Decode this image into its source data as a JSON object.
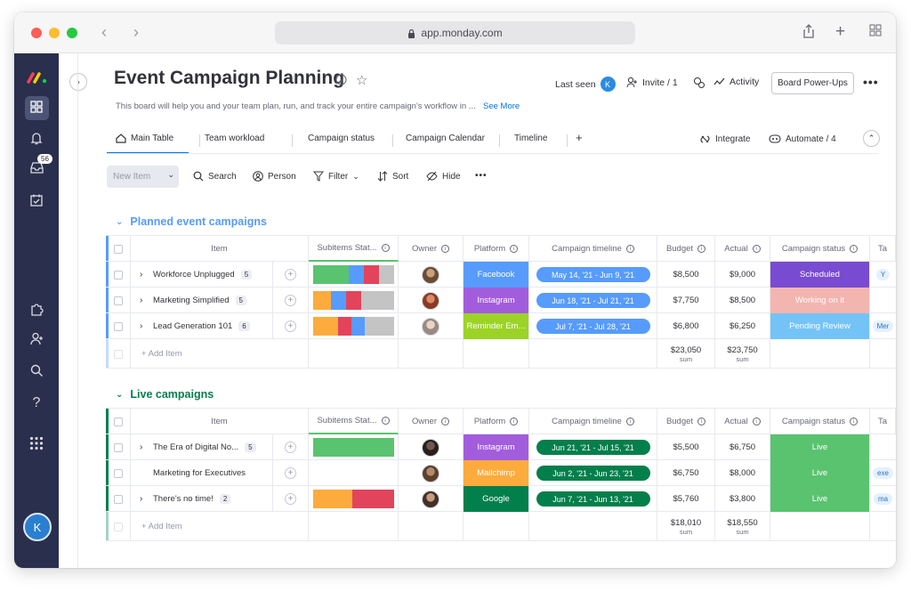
{
  "browser": {
    "url": "app.monday.com"
  },
  "colors": {
    "accent": "#0073ea",
    "group1": "#579bfc",
    "group2": "#037f4c",
    "facebook": "#579bfc",
    "instagram": "#a25ddc",
    "reminder": "#9cd326",
    "mailchimp": "#fdab3d",
    "google": "#037f4c",
    "timeline_blue": "#579bfc",
    "timeline_green": "#037f4c",
    "scheduled": "#784bd1",
    "working": "#f3b5b0",
    "pending": "#74c3f7",
    "live": "#5ac36f"
  },
  "rail": {
    "badge": "56",
    "avatar": "K",
    "icons": [
      "monday-logo-icon",
      "grid-icon",
      "bell-icon",
      "inbox-icon",
      "calendar-check-icon",
      "puzzle-icon",
      "add-user-icon",
      "search-icon",
      "help-icon",
      "apps-icon"
    ]
  },
  "header": {
    "title": "Event Campaign Planning",
    "last_seen": "Last seen",
    "last_seen_avatar": "K",
    "invite": "Invite / 1",
    "activity": "Activity",
    "powerups": "Board Power-Ups",
    "description": "This board will help you and your team plan, run, and track your entire campaign's workflow in ...",
    "see_more": "See More"
  },
  "tabs": [
    "Main Table",
    "Team workload",
    "Campaign status",
    "Campaign Calendar",
    "Timeline"
  ],
  "tabs_add": "+",
  "integrate": "Integrate",
  "automate": "Automate / 4",
  "toolbar": {
    "new_item": "New Item",
    "search": "Search",
    "person": "Person",
    "filter": "Filter",
    "sort": "Sort",
    "hide": "Hide"
  },
  "columns": {
    "item": "Item",
    "subitems": "Subitems Stat...",
    "owner": "Owner",
    "platform": "Platform",
    "timeline": "Campaign timeline",
    "budget": "Budget",
    "actual": "Actual",
    "status": "Campaign status",
    "tags": "Ta"
  },
  "groups": [
    {
      "title": "Planned event campaigns",
      "rows": [
        {
          "name": "Workforce Unplugged",
          "count": "5",
          "platform": "Facebook",
          "timeline": "May 14, '21 - Jun 9, '21",
          "budget": "$8,500",
          "actual": "$9,000",
          "status": "Scheduled",
          "tag": "Y"
        },
        {
          "name": "Marketing Simplified",
          "count": "5",
          "platform": "Instagram",
          "timeline": "Jun 18, '21 - Jul 21, '21",
          "budget": "$7,750",
          "actual": "$8,500",
          "status": "Working on it",
          "tag": ""
        },
        {
          "name": "Lead Generation 101",
          "count": "6",
          "platform": "Reminder Em...",
          "timeline": "Jul 7, '21 - Jul 28, '21",
          "budget": "$6,800",
          "actual": "$6,250",
          "status": "Pending Review",
          "tag": "Mer"
        }
      ],
      "add_item": "+ Add Item",
      "budget_sum": "$23,050",
      "actual_sum": "$23,750",
      "sum_label": "sum"
    },
    {
      "title": "Live campaigns",
      "rows": [
        {
          "name": "The Era of Digital No...",
          "count": "5",
          "platform": "Instagram",
          "timeline": "Jun 21, '21 - Jul 15, '21",
          "budget": "$5,500",
          "actual": "$6,750",
          "status": "Live",
          "tag": ""
        },
        {
          "name": "Marketing for Executives",
          "count": "",
          "platform": "Mailchimp",
          "timeline": "Jun 2, '21 - Jun 23, '21",
          "budget": "$6,750",
          "actual": "$8,000",
          "status": "Live",
          "tag": "exe"
        },
        {
          "name": "There's no time!",
          "count": "2",
          "platform": "Google",
          "timeline": "Jun 7, '21 - Jun 13, '21",
          "budget": "$5,760",
          "actual": "$3,800",
          "status": "Live",
          "tag": "ma"
        }
      ],
      "add_item": "+ Add Item",
      "budget_sum": "$18,010",
      "actual_sum": "$18,550",
      "sum_label": "sum"
    }
  ]
}
